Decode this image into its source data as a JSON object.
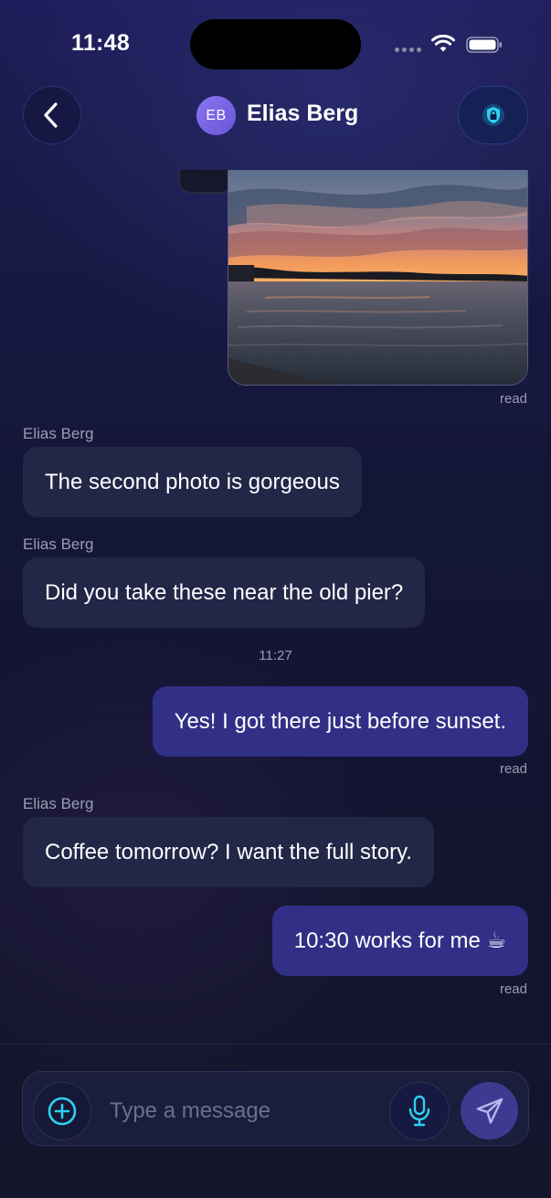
{
  "status_bar": {
    "time": "11:48",
    "icons": [
      "cellular-signal-icon",
      "wifi-icon",
      "battery-icon"
    ]
  },
  "header": {
    "back_icon": "chevron-left-icon",
    "avatar_initials": "EB",
    "contact_name": "Elias Berg",
    "secure_icon": "lock-shield-icon"
  },
  "messages": [
    {
      "direction": "outgoing",
      "type": "image",
      "image_description": "sunset-over-water-photo",
      "status": "read"
    },
    {
      "direction": "incoming",
      "sender": "Elias Berg",
      "text": "The second photo is gorgeous"
    },
    {
      "direction": "incoming",
      "sender": "Elias Berg",
      "text": "Did you take these near the old pier?"
    },
    {
      "type": "time_separator",
      "time": "11:27"
    },
    {
      "direction": "outgoing",
      "text": "Yes! I got there just before sunset.",
      "status": "read"
    },
    {
      "direction": "incoming",
      "sender": "Elias Berg",
      "text": "Coffee tomorrow? I want the full story."
    },
    {
      "direction": "outgoing",
      "text": "10:30 works for me ☕",
      "status": "read"
    }
  ],
  "composer": {
    "attach_icon": "plus-circle-icon",
    "placeholder": "Type a message",
    "value": "",
    "mic_icon": "microphone-icon",
    "send_icon": "paper-plane-icon"
  },
  "colors": {
    "background_top": "#1e1c5a",
    "background_bottom": "#15152c",
    "incoming_bubble": "#222647",
    "outgoing_bubble": "#312f86",
    "accent_cyan": "#2fd0f0",
    "send_button": "#3d3a91",
    "meta_text": "#9a9cb4"
  }
}
